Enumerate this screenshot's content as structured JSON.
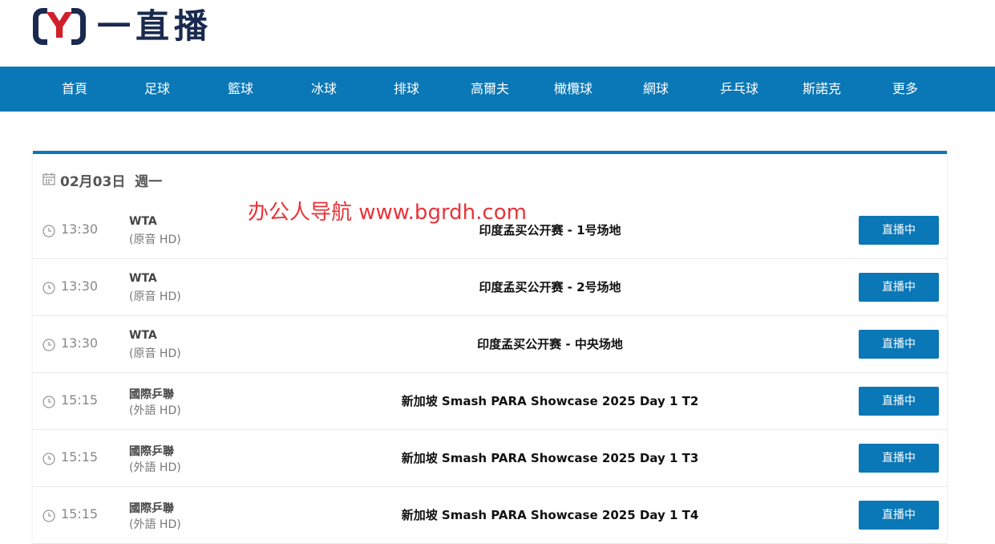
{
  "site": {
    "logo_text": "一直播",
    "logo_mark": "Y"
  },
  "nav": {
    "items": [
      {
        "label": "首頁"
      },
      {
        "label": "足球"
      },
      {
        "label": "籃球"
      },
      {
        "label": "冰球"
      },
      {
        "label": "排球"
      },
      {
        "label": "高爾夫"
      },
      {
        "label": "橄欖球"
      },
      {
        "label": "網球"
      },
      {
        "label": "乒乓球"
      },
      {
        "label": "斯諾克"
      },
      {
        "label": "更多"
      }
    ]
  },
  "watermark": "办公人导航  www.bgrdh.com",
  "schedule": {
    "date": "02月03日",
    "weekday": "週一",
    "rows": [
      {
        "time": "13:30",
        "league": "WTA",
        "sub": "(原音 HD)",
        "match": "印度孟买公开赛 - 1号场地",
        "button": "直播中"
      },
      {
        "time": "13:30",
        "league": "WTA",
        "sub": "(原音 HD)",
        "match": "印度孟买公开赛 - 2号场地",
        "button": "直播中"
      },
      {
        "time": "13:30",
        "league": "WTA",
        "sub": "(原音 HD)",
        "match": "印度孟买公开赛 - 中央场地",
        "button": "直播中"
      },
      {
        "time": "15:15",
        "league": "國際乒聯",
        "sub": "(外語 HD)",
        "match": "新加坡 Smash PARA Showcase 2025 Day 1 T2",
        "button": "直播中"
      },
      {
        "time": "15:15",
        "league": "國際乒聯",
        "sub": "(外語 HD)",
        "match": "新加坡 Smash PARA Showcase 2025 Day 1 T3",
        "button": "直播中"
      },
      {
        "time": "15:15",
        "league": "國際乒聯",
        "sub": "(外語 HD)",
        "match": "新加坡 Smash PARA Showcase 2025 Day 1 T4",
        "button": "直播中"
      }
    ]
  },
  "colors": {
    "brand_blue": "#0a77b6",
    "logo_red": "#d0202b",
    "logo_navy": "#1a2a4f",
    "watermark_red": "#e8333a"
  }
}
